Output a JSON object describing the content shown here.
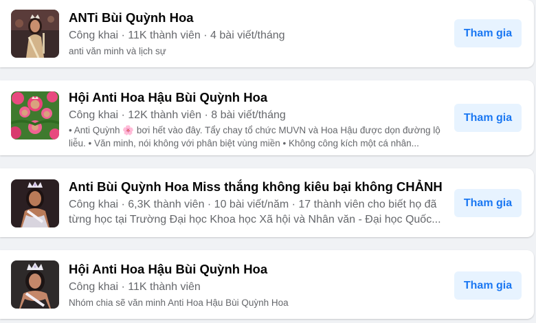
{
  "groups": [
    {
      "name": "ANTi Bùi Quỳnh Hoa",
      "meta": "Công khai · 11K thành viên · 4 bài viết/tháng",
      "description": "anti văn minh và lịch sự",
      "button_label": "Tham gia",
      "thumbnail_icon": "group-photo-crowned-woman-dark-background"
    },
    {
      "name": "Hội Anti Hoa Hậu Bùi Quỳnh Hoa",
      "meta": "Công khai · 12K thành viên · 8 bài viết/tháng",
      "description": "• Anti Quỳnh 🌸 bơi hết vào đây. Tẩy chay tổ chức MUVN và Hoa Hậu được dọn đường lộ liễu. • Văn minh, nói không với phân biệt vùng miền • Không công kích một cá nhân...",
      "button_label": "Tham gia",
      "thumbnail_icon": "group-photo-pink-flowers-crowned-faces"
    },
    {
      "name": "Anti Bùi Quỳnh Hoa Miss thắng không kiêu bại không CHẢNH",
      "meta": "Công khai · 6,3K thành viên · 10 bài viết/năm · 17 thành viên cho biết họ đã từng học tại Trường Đại học Khoa học Xã hội và Nhân văn - Đại học Quốc...",
      "description": "",
      "button_label": "Tham gia",
      "thumbnail_icon": "group-photo-crowned-woman-dark-background"
    },
    {
      "name": "Hội Anti Hoa Hậu Bùi Quỳnh Hoa",
      "meta": "Công khai · 11K thành viên",
      "description": "Nhóm chia sẽ văn minh Anti Hoa Hậu Bùi Quỳnh Hoa",
      "button_label": "Tham gia",
      "thumbnail_icon": "group-photo-crowned-woman-dark-background"
    }
  ],
  "colors": {
    "page_background": "#f0f2f5",
    "card_background": "#ffffff",
    "title_text": "#050505",
    "secondary_text": "#65676b",
    "button_background": "#e7f3ff",
    "button_text": "#1a77f2"
  }
}
